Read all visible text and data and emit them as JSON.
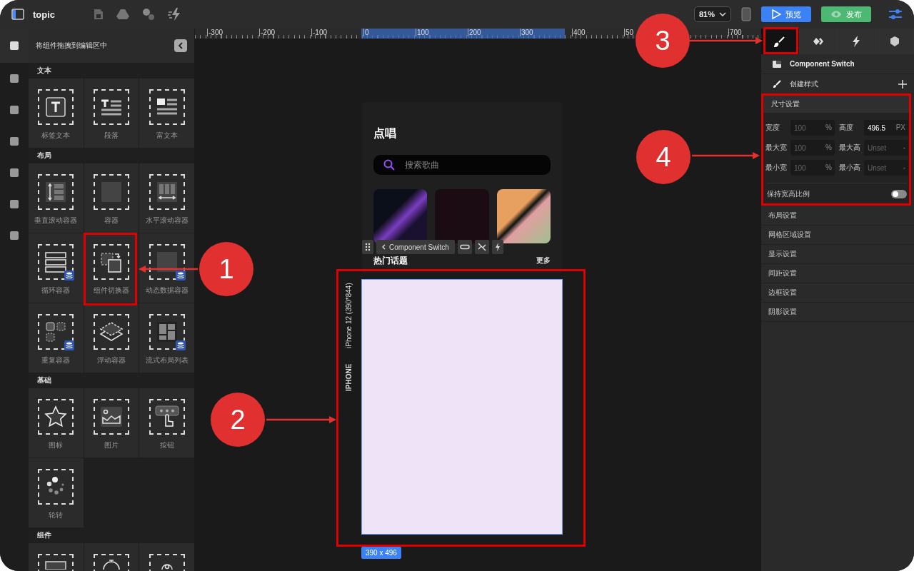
{
  "topbar": {
    "title": "topic",
    "zoom": "81%",
    "preview_button": "预览",
    "publish_button": "发布"
  },
  "rail": [
    {
      "selected": true
    },
    {
      "selected": false
    },
    {
      "selected": false
    },
    {
      "selected": false
    },
    {
      "selected": false
    },
    {
      "selected": false
    },
    {
      "selected": false
    }
  ],
  "left_panel": {
    "title": "将组件拖拽到编辑区中",
    "sections": [
      {
        "title": "文本",
        "items": [
          {
            "label": "标签文本",
            "data_badge": false
          },
          {
            "label": "段落",
            "data_badge": false
          },
          {
            "label": "富文本",
            "data_badge": false
          }
        ]
      },
      {
        "title": "布局",
        "items": [
          {
            "label": "垂直滚动容器",
            "data_badge": false
          },
          {
            "label": "容器",
            "data_badge": false
          },
          {
            "label": "水平滚动容器",
            "data_badge": false
          },
          {
            "label": "循环容器",
            "data_badge": true
          },
          {
            "label": "组件切换器",
            "data_badge": false
          },
          {
            "label": "动态数据容器",
            "data_badge": true
          },
          {
            "label": "重复容器",
            "data_badge": true
          },
          {
            "label": "浮动容器",
            "data_badge": false
          },
          {
            "label": "流式布局列表",
            "data_badge": true
          }
        ]
      },
      {
        "title": "基础",
        "items": [
          {
            "label": "图标",
            "data_badge": false
          },
          {
            "label": "图片",
            "data_badge": false
          },
          {
            "label": "按钮",
            "data_badge": false
          },
          {
            "label": "轮转",
            "data_badge": false
          }
        ]
      },
      {
        "title": "组件"
      }
    ]
  },
  "ruler": {
    "labels": [
      "-300",
      "-200",
      "-100",
      "0",
      "100",
      "200",
      "300",
      "400",
      "50",
      "700"
    ]
  },
  "canvas": {
    "page_title": "点唱",
    "search": {
      "placeholder": "搜索歌曲"
    },
    "toolbar_label": "Component Switch",
    "section_title": "热门话题",
    "more_link": "更多",
    "device_label": "iPhone 12 (390*844)",
    "device_name": "IPHONE",
    "size_badge": "390 x 496"
  },
  "right_panel": {
    "tabs": [
      {
        "selected": true
      },
      {
        "selected": false
      },
      {
        "selected": false
      },
      {
        "selected": false
      }
    ],
    "component_name": "Component Switch",
    "create_style": "创建样式",
    "size_section": {
      "title": "尺寸设置",
      "fields": [
        {
          "label": "宽度",
          "placeholder": "100",
          "unit": "%"
        },
        {
          "label": "高度",
          "value": "496.5",
          "unit": "PX"
        },
        {
          "label": "最大宽",
          "placeholder": "100",
          "unit": "%"
        },
        {
          "label": "最大高",
          "placeholder": "Unset",
          "unit": "-"
        },
        {
          "label": "最小宽",
          "placeholder": "100",
          "unit": "%"
        },
        {
          "label": "最小高",
          "placeholder": "Unset",
          "unit": "-"
        }
      ],
      "keep_ratio": {
        "label": "保持宽高比例",
        "on": false
      }
    },
    "sections": [
      "布局设置",
      "网格区域设置",
      "显示设置",
      "间距设置",
      "边框设置",
      "阴影设置"
    ]
  },
  "annotations": [
    {
      "label": "1"
    },
    {
      "label": "2"
    },
    {
      "label": "3"
    },
    {
      "label": "4"
    }
  ]
}
